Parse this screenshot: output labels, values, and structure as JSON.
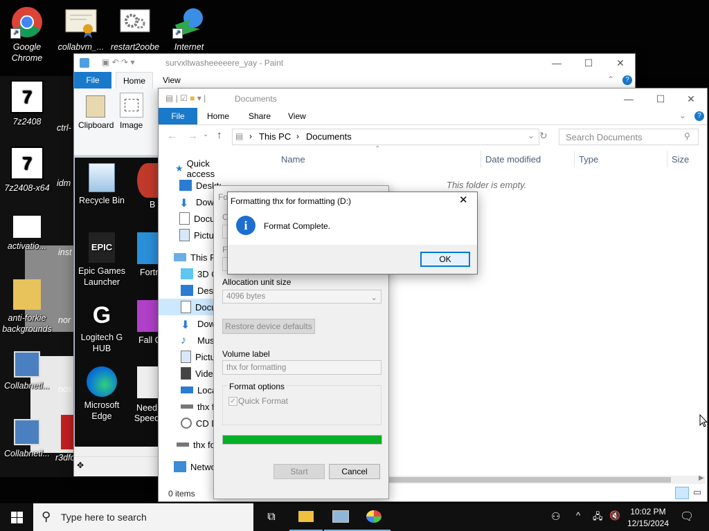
{
  "desktop": {
    "icons": [
      {
        "label": "Google Chrome",
        "icon": "chrome-icon"
      },
      {
        "label": "collabvm_...",
        "icon": "certificate-icon"
      },
      {
        "label": "restart2oobe",
        "icon": "gears-icon"
      },
      {
        "label": "Internet",
        "icon": "internet-download-icon"
      },
      {
        "label": "7z2408",
        "icon": "7zip-icon"
      },
      {
        "label": "7z2408-x64",
        "icon": "7zip-icon"
      },
      {
        "label": "idm",
        "icon": "idm-icon"
      },
      {
        "label": "activatio...",
        "icon": "gears-icon"
      },
      {
        "label": "inst",
        "icon": "app-icon"
      },
      {
        "label": "anti-forkie backgrounds",
        "icon": "folder-zip-icon"
      },
      {
        "label": "nor",
        "icon": "app-icon"
      },
      {
        "label": "Collabnetl...",
        "icon": "network-computer-icon"
      },
      {
        "label": "nos",
        "icon": "app-icon"
      },
      {
        "label": "Collabnetl...",
        "icon": "network-computer-icon"
      },
      {
        "label": "r3dfo",
        "icon": "app-icon"
      },
      {
        "label": "ctrl-",
        "icon": "app-icon"
      }
    ],
    "panel_icons": [
      {
        "label": "Recycle Bin",
        "icon": "recycle-bin-icon"
      },
      {
        "label": "Epic Games Launcher",
        "icon": "epic-games-icon"
      },
      {
        "label": "Logitech G HUB",
        "icon": "logitech-icon"
      },
      {
        "label": "Microsoft Edge",
        "icon": "edge-icon"
      },
      {
        "label": "B",
        "icon": "app-icon"
      },
      {
        "label": "Fortn",
        "icon": "fortnite-icon"
      },
      {
        "label": "Fall G",
        "icon": "fall-guys-icon"
      },
      {
        "label": "Need Speed",
        "icon": "need-for-speed-icon"
      }
    ]
  },
  "paint": {
    "title": "survxltwasheeeeere_yay - Paint",
    "tabs": [
      "File",
      "Home",
      "View"
    ],
    "groups": [
      "Clipboard",
      "Image"
    ]
  },
  "explorer": {
    "title": "Documents",
    "tabs": [
      "File",
      "Home",
      "Share",
      "View"
    ],
    "breadcrumb": [
      "This PC",
      "Documents"
    ],
    "search_placeholder": "Search Documents",
    "columns": [
      "Name",
      "Date modified",
      "Type",
      "Size"
    ],
    "empty_text": "This folder is empty.",
    "status": "0 items",
    "nav": {
      "quick_access": "Quick access",
      "quick_items": [
        "Desktop",
        "Dow",
        "Docu",
        "Pictu"
      ],
      "this_pc": "This P",
      "pc_items": [
        "3D O",
        "Desk",
        "Docu",
        "Dow",
        "Musi",
        "Pictu",
        "Vide",
        "Loca",
        "thx f",
        "CD D"
      ],
      "drive": "thx fo",
      "network": "Netwo"
    }
  },
  "format_dialog": {
    "title_partial": "Fo",
    "partial_labels": [
      "Ca",
      "Fi"
    ],
    "allocation_label": "Allocation unit size",
    "allocation_value": "4096 bytes",
    "restore_button": "Restore device defaults",
    "volume_label": "Volume label",
    "volume_value": "thx for formatting",
    "format_options": "Format options",
    "quick_format": "Quick Format",
    "progress": 1.0,
    "start_button": "Start",
    "cancel_button": "Cancel"
  },
  "message_box": {
    "title": "Formatting thx for formatting (D:)",
    "message": "Format Complete.",
    "ok_button": "OK"
  },
  "taskbar": {
    "search_placeholder": "Type here to search",
    "time": "10:02 PM",
    "date": "12/15/2024"
  },
  "colors": {
    "accent": "#0078d7",
    "progress_green": "#06b025",
    "taskbar": "#101010"
  }
}
